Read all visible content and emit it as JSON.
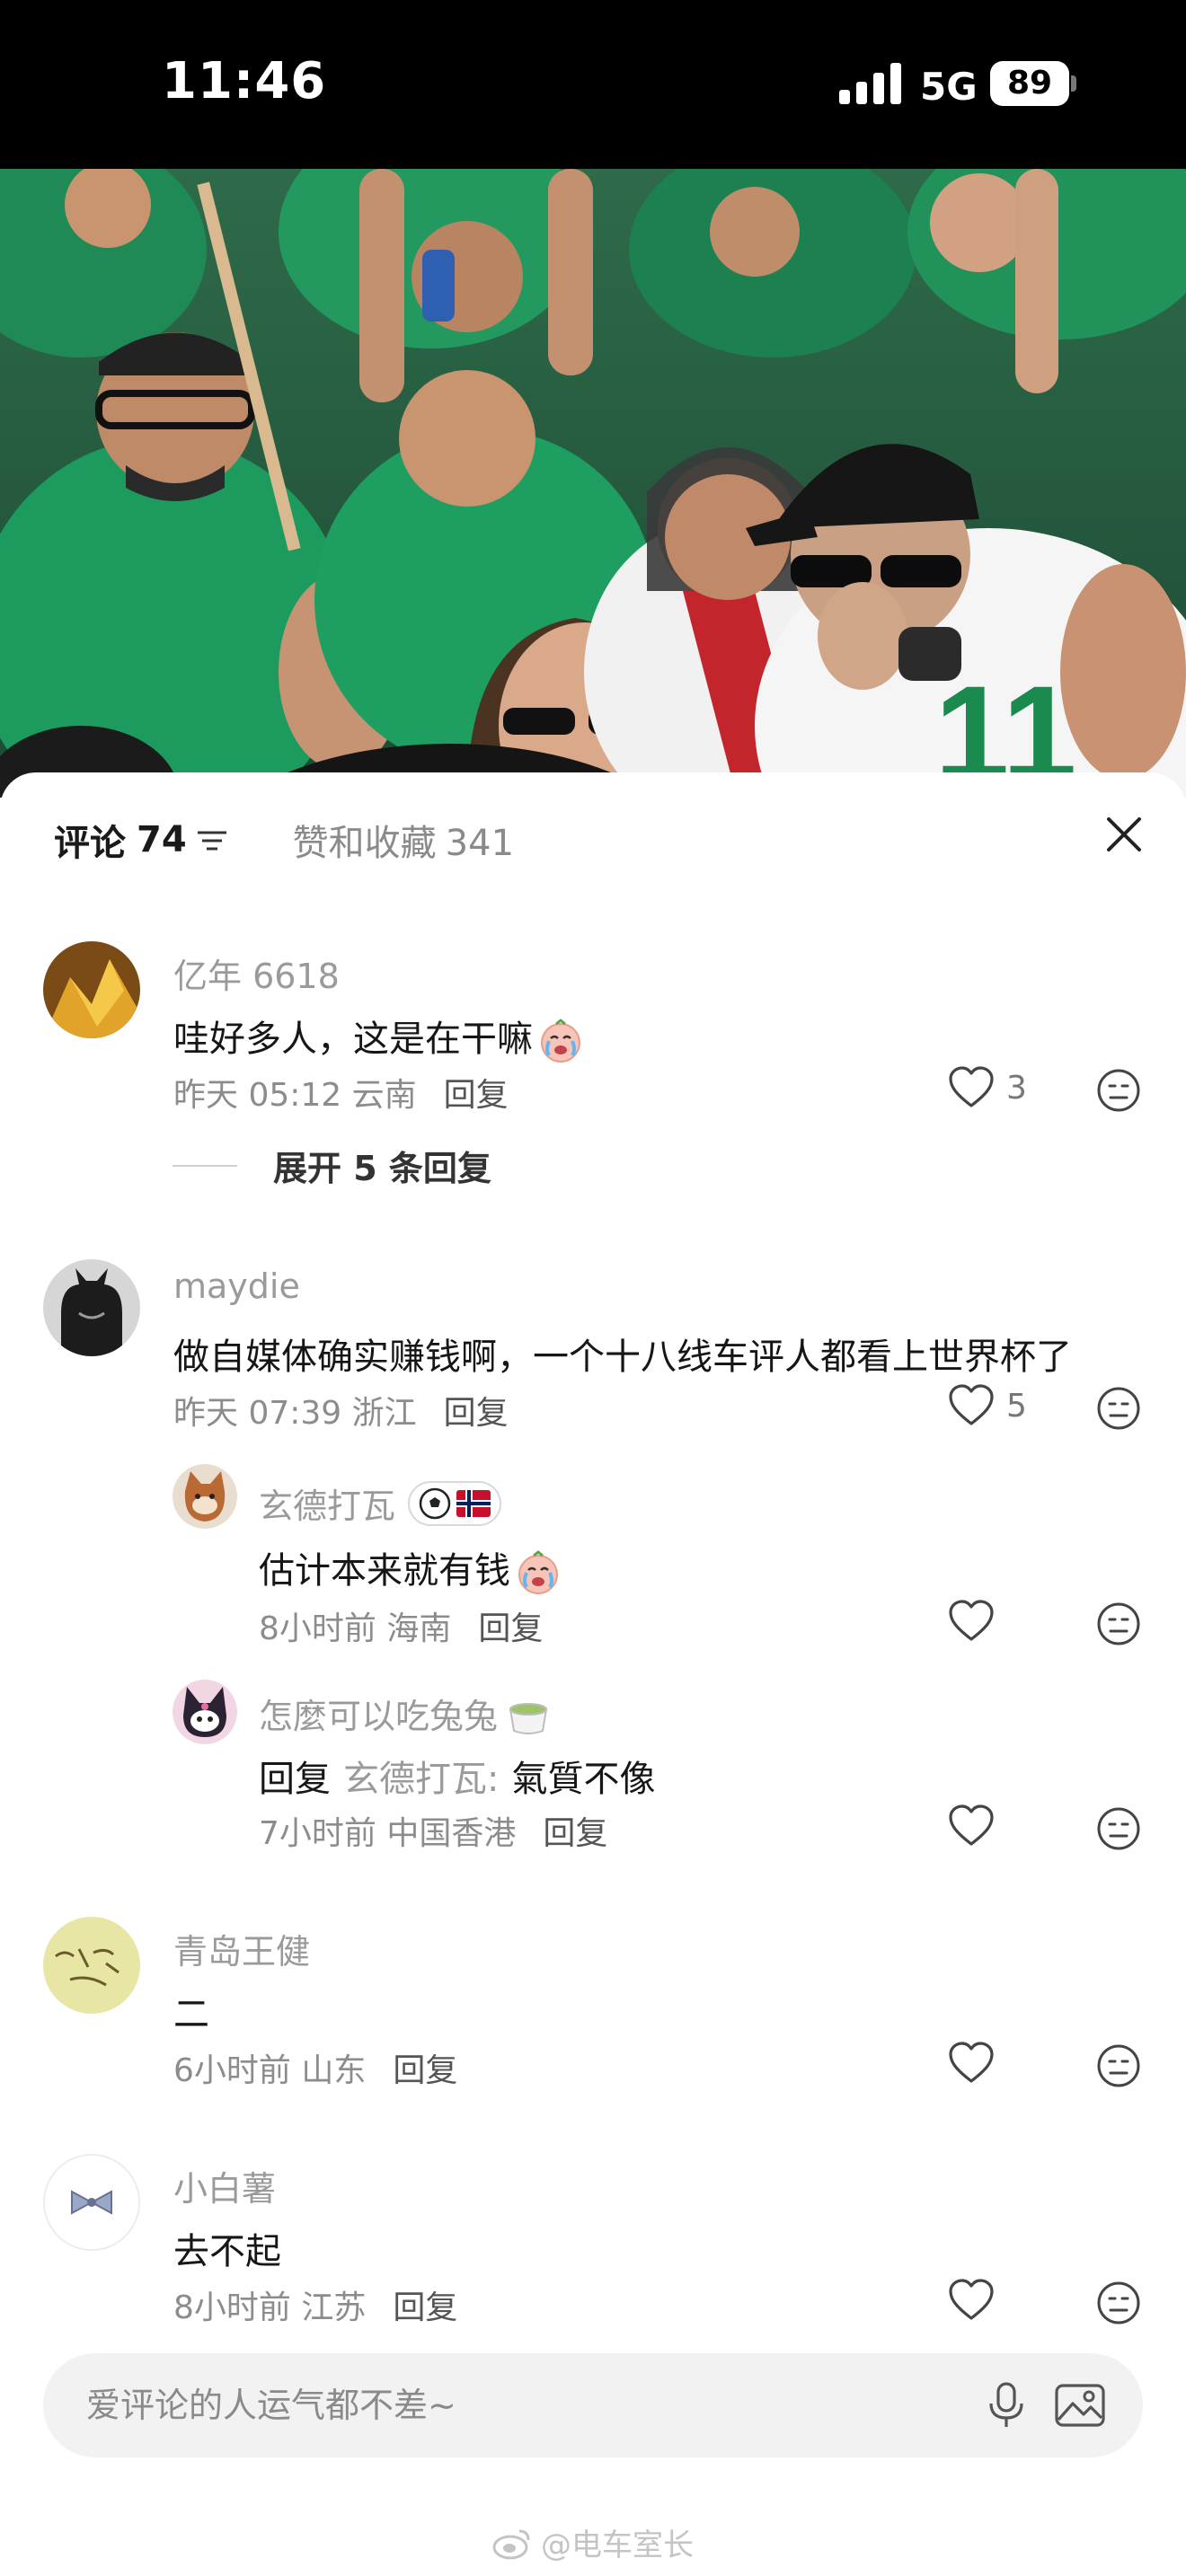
{
  "status_bar": {
    "time": "11:46",
    "network": "5G",
    "battery": "89"
  },
  "tabs": {
    "comments_label": "评论",
    "comments_count": "74",
    "likes_label": "赞和收藏",
    "likes_count": "341"
  },
  "comments": [
    {
      "user": "亿年 6618",
      "text": "哇好多人，这是在干嘛",
      "time": "昨天 05:12",
      "location": "云南",
      "reply": "回复",
      "likes": "3",
      "expand": "展开 5 条回复"
    },
    {
      "user": "maydie",
      "text": "做自媒体确实赚钱啊，一个十八线车评人都看上世界杯了",
      "time": "昨天 07:39",
      "location": "浙江",
      "reply": "回复",
      "likes": "5"
    },
    {
      "user": "青岛王健",
      "text": "二",
      "time": "6小时前",
      "location": "山东",
      "reply": "回复"
    },
    {
      "user": "小白薯",
      "text": "去不起",
      "time": "8小时前",
      "location": "江苏",
      "reply": "回复"
    }
  ],
  "replies": [
    {
      "user": "玄德打瓦",
      "text": "估计本来就有钱",
      "time": "8小时前",
      "location": "海南",
      "reply": "回复"
    },
    {
      "user": "怎麼可以吃兔兔",
      "reply_prefix": "回复",
      "reply_to": "玄德打瓦:",
      "text": "氣質不像",
      "time": "7小时前",
      "location": "中国香港",
      "reply": "回复"
    }
  ],
  "input": {
    "placeholder": "爱评论的人运气都不差~"
  },
  "watermark": "@电车室长"
}
